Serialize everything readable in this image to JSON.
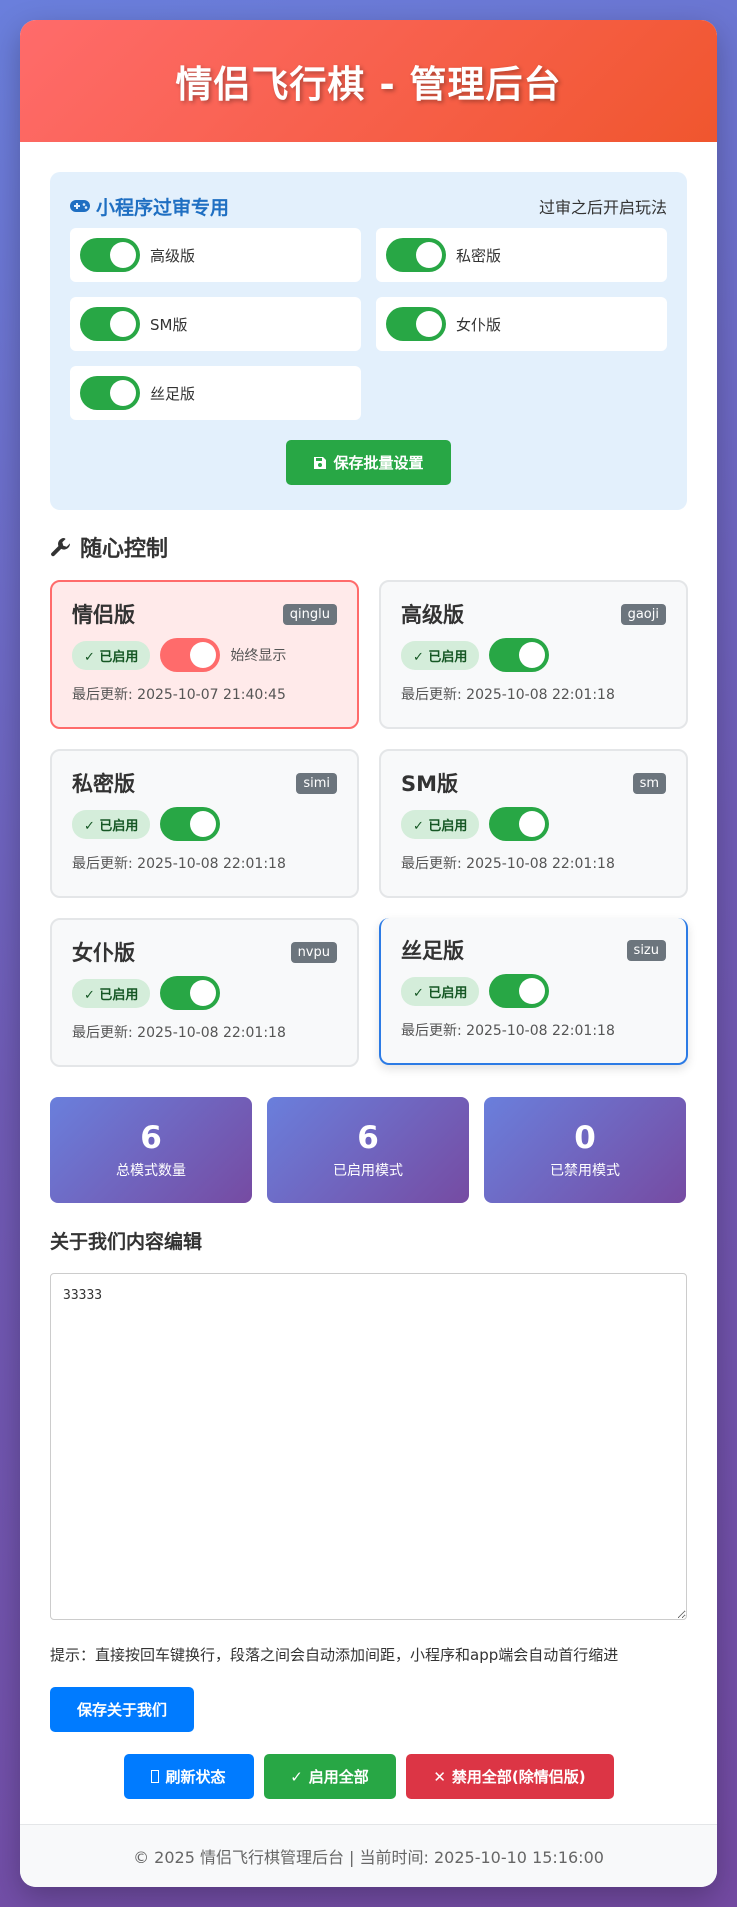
{
  "header": {
    "title": "情侣飞行棋 - 管理后台"
  },
  "audit": {
    "title": "小程序过审专用",
    "note": "过审之后开启玩法",
    "items": [
      {
        "label": "高级版",
        "enabled": true
      },
      {
        "label": "私密版",
        "enabled": true
      },
      {
        "label": "SM版",
        "enabled": true
      },
      {
        "label": "女仆版",
        "enabled": true
      },
      {
        "label": "丝足版",
        "enabled": true
      }
    ],
    "save_label": "保存批量设置"
  },
  "control": {
    "title": "随心控制"
  },
  "modes": [
    {
      "name": "情侣版",
      "code": "qinglu",
      "status": "已启用",
      "always": "始终显示",
      "updated": "最后更新: 2025-10-07 21:40:45"
    },
    {
      "name": "高级版",
      "code": "gaoji",
      "status": "已启用",
      "updated": "最后更新: 2025-10-08 22:01:18"
    },
    {
      "name": "私密版",
      "code": "simi",
      "status": "已启用",
      "updated": "最后更新: 2025-10-08 22:01:18"
    },
    {
      "name": "SM版",
      "code": "sm",
      "status": "已启用",
      "updated": "最后更新: 2025-10-08 22:01:18"
    },
    {
      "name": "女仆版",
      "code": "nvpu",
      "status": "已启用",
      "updated": "最后更新: 2025-10-08 22:01:18"
    },
    {
      "name": "丝足版",
      "code": "sizu",
      "status": "已启用",
      "updated": "最后更新: 2025-10-08 22:01:18"
    }
  ],
  "stats": [
    {
      "value": "6",
      "label": "总模式数量"
    },
    {
      "value": "6",
      "label": "已启用模式"
    },
    {
      "value": "0",
      "label": "已禁用模式"
    }
  ],
  "about": {
    "title": "关于我们内容编辑",
    "content": "33333",
    "hint": "提示：直接按回车键换行，段落之间会自动添加间距，小程序和app端会自动首行缩进",
    "save_label": "保存关于我们"
  },
  "actions": {
    "refresh_label": "刷新状态",
    "enable_all_label": "启用全部",
    "disable_all_label": "禁用全部(除情侣版)"
  },
  "footer": {
    "text": "© 2025 情侣飞行棋管理后台 | 当前时间: 2025-10-10 15:16:00"
  },
  "colors": {
    "header": "#ff6b6b",
    "toggle_on": "#28a745",
    "primary": "#007bff",
    "danger": "#dc3545"
  }
}
